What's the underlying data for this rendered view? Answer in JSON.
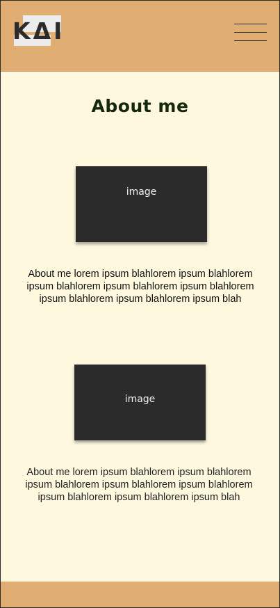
{
  "header": {
    "logo_text": "KΔI",
    "menu_icon": "hamburger-menu-icon"
  },
  "main": {
    "title": "About me",
    "sections": [
      {
        "image_label": "image",
        "text": "About me lorem ipsum blahlorem ipsum blahlorem ipsum blahlorem ipsum blahlorem ipsum blahlorem ipsum blahlorem ipsum blahlorem ipsum blah"
      },
      {
        "image_label": "image",
        "text": "About me lorem ipsum blahlorem ipsum blahlorem ipsum blahlorem ipsum blahlorem ipsum blahlorem ipsum blahlorem ipsum blahlorem ipsum blah"
      }
    ]
  },
  "colors": {
    "header_bg": "#e0ae73",
    "page_bg": "#fdf8de",
    "title": "#162710",
    "image_placeholder": "#2b2b2b"
  }
}
